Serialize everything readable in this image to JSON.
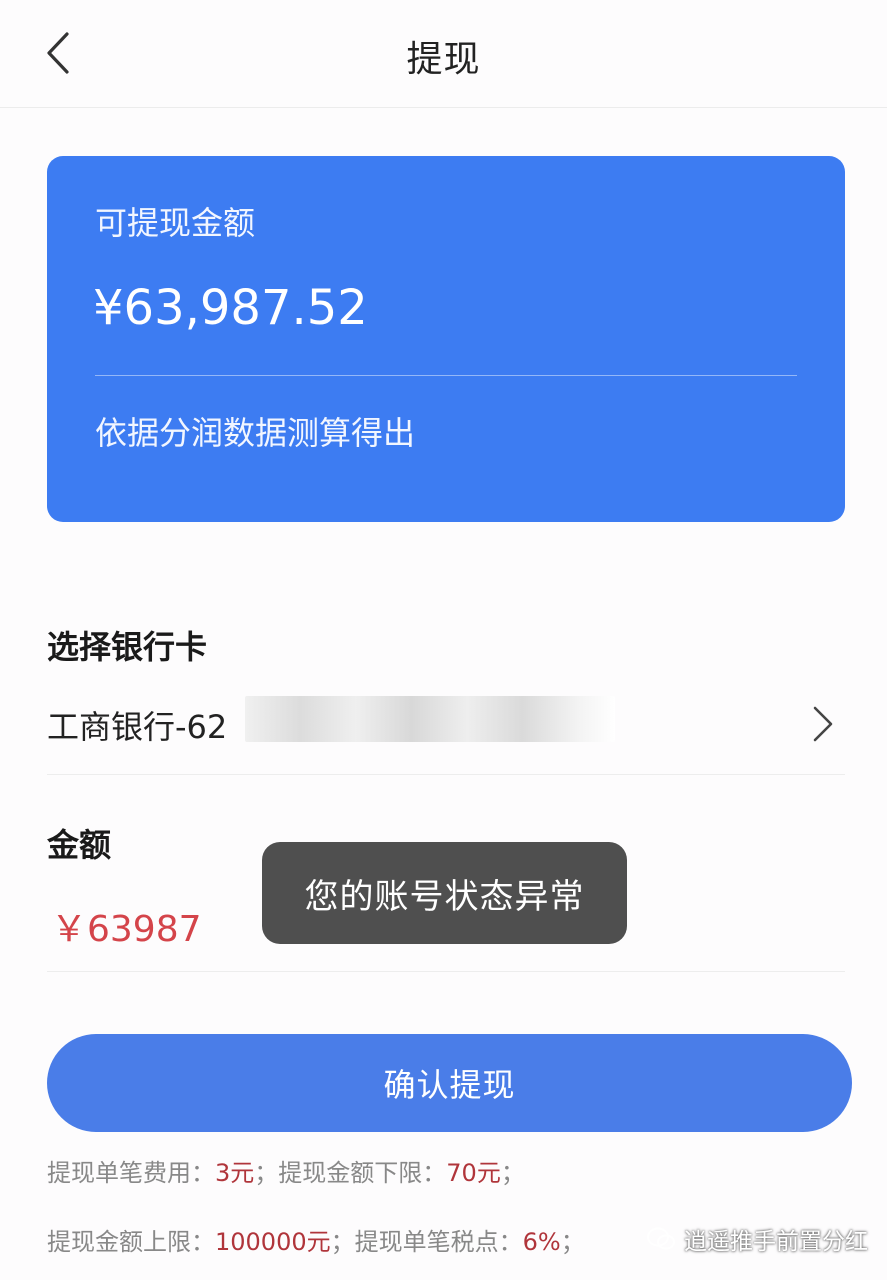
{
  "header": {
    "title": "提现"
  },
  "balance_card": {
    "label": "可提现金额",
    "amount": "¥63,987.52",
    "note": "依据分润数据测算得出"
  },
  "bank_section": {
    "title": "选择银行卡",
    "selected_card": "工商银行-62"
  },
  "amount_section": {
    "title": "金额",
    "value": "￥63987"
  },
  "toast": {
    "message": "您的账号状态异常"
  },
  "confirm_button": {
    "label": "确认提现"
  },
  "fee_info": {
    "line1": {
      "fee_label": "提现单笔费用：",
      "fee_value": "3元",
      "sep1": "；",
      "min_label": "提现金额下限：",
      "min_value": "70元",
      "sep2": "；"
    },
    "line2": {
      "max_label": "提现金额上限：",
      "max_value": "100000元",
      "sep1": "；",
      "tax_label": "提现单笔税点：",
      "tax_value": "6%",
      "sep2": "；"
    }
  },
  "watermark": {
    "text": "逍遥推手前置分红"
  },
  "colors": {
    "card_bg": "#3d7cf2",
    "button_bg": "#4a7de8",
    "amount_red": "#d4444a",
    "highlight_red": "#b0353b",
    "toast_bg": "#484848"
  }
}
